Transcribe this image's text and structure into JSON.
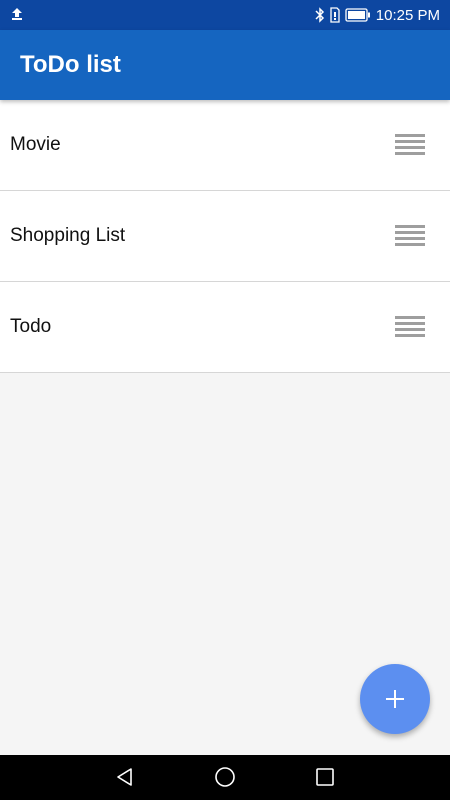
{
  "status_bar": {
    "time": "10:25 PM",
    "icons": [
      "upload-icon",
      "bluetooth-icon",
      "sim-icon",
      "battery-icon"
    ]
  },
  "app_bar": {
    "title": "ToDo list",
    "color": "#1565c0"
  },
  "lists": [
    {
      "label": "Movie",
      "icon": "drag-handle-icon"
    },
    {
      "label": "Shopping List",
      "icon": "drag-handle-icon"
    },
    {
      "label": "Todo",
      "icon": "drag-handle-icon"
    }
  ],
  "fab": {
    "icon": "plus-icon",
    "color": "#5c8ff0"
  },
  "nav_bar": {
    "icons": [
      "back-icon",
      "home-icon",
      "recents-icon"
    ]
  }
}
